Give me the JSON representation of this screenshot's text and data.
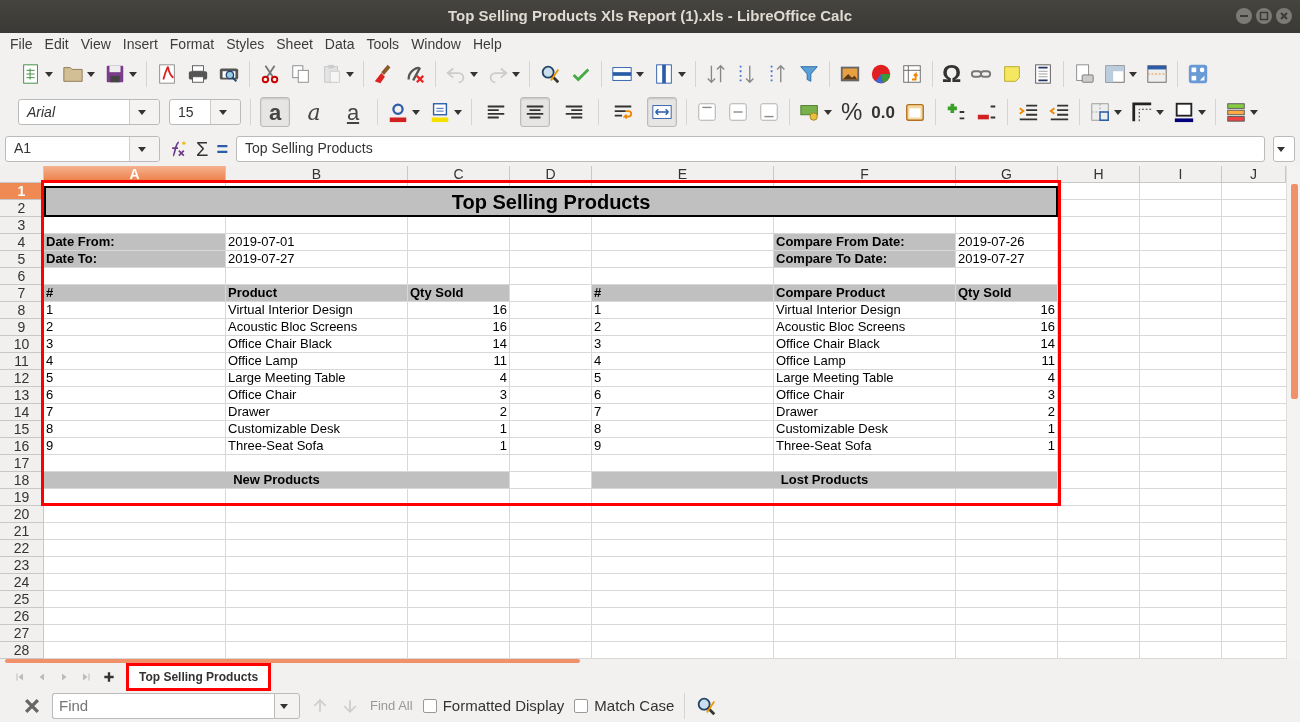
{
  "window": {
    "title": "Top Selling Products Xls Report (1).xls - LibreOffice Calc"
  },
  "menu": [
    "File",
    "Edit",
    "View",
    "Insert",
    "Format",
    "Styles",
    "Sheet",
    "Data",
    "Tools",
    "Window",
    "Help"
  ],
  "toolbar_standard": {
    "special_character_glyph": "Ω"
  },
  "toolbar_format": {
    "font_name": "Arial",
    "font_size": "15",
    "text_style_buttons": [
      {
        "glyph": "a",
        "kind": "bold",
        "selected": true
      },
      {
        "glyph": "a",
        "kind": "italic",
        "selected": false
      },
      {
        "glyph": "a",
        "kind": "underline",
        "selected": false
      }
    ],
    "align_buttons": [
      {
        "kind": "left",
        "selected": false
      },
      {
        "kind": "center",
        "selected": true
      },
      {
        "kind": "right",
        "selected": false
      }
    ],
    "wrap_merge_buttons": [
      {
        "kind": "wrap",
        "selected": false
      },
      {
        "kind": "merge",
        "selected": true
      }
    ],
    "number_glyphs": [
      "%",
      "0.0"
    ]
  },
  "formula_bar": {
    "name_box": "A1",
    "glyphs": [
      "Σ",
      "="
    ],
    "content": "Top Selling Products"
  },
  "sheet": {
    "columns": [
      {
        "label": "A",
        "selected": true
      },
      {
        "label": "B",
        "selected": false
      },
      {
        "label": "C",
        "selected": false
      },
      {
        "label": "D",
        "selected": false
      },
      {
        "label": "E",
        "selected": false
      },
      {
        "label": "F",
        "selected": false
      },
      {
        "label": "G",
        "selected": false
      },
      {
        "label": "H",
        "selected": false
      },
      {
        "label": "I",
        "selected": false
      },
      {
        "label": "J",
        "selected": false
      }
    ],
    "rows": [
      {
        "label": "1",
        "selected": true
      },
      {
        "label": "2",
        "selected": false
      },
      {
        "label": "3",
        "selected": false
      },
      {
        "label": "4",
        "selected": false
      },
      {
        "label": "5",
        "selected": false
      },
      {
        "label": "6",
        "selected": false
      },
      {
        "label": "7",
        "selected": false
      },
      {
        "label": "8",
        "selected": false
      },
      {
        "label": "9",
        "selected": false
      },
      {
        "label": "10",
        "selected": false
      },
      {
        "label": "11",
        "selected": false
      },
      {
        "label": "12",
        "selected": false
      },
      {
        "label": "13",
        "selected": false
      },
      {
        "label": "14",
        "selected": false
      },
      {
        "label": "15",
        "selected": false
      },
      {
        "label": "16",
        "selected": false
      },
      {
        "label": "17",
        "selected": false
      },
      {
        "label": "18",
        "selected": false
      },
      {
        "label": "19",
        "selected": false
      },
      {
        "label": "20",
        "selected": false
      },
      {
        "label": "21",
        "selected": false
      },
      {
        "label": "22",
        "selected": false
      },
      {
        "label": "23",
        "selected": false
      },
      {
        "label": "24",
        "selected": false
      },
      {
        "label": "25",
        "selected": false
      },
      {
        "label": "26",
        "selected": false
      },
      {
        "label": "27",
        "selected": false
      },
      {
        "label": "28",
        "selected": false
      }
    ]
  },
  "report": {
    "title": "Top Selling Products",
    "date_from_label": "Date From:",
    "date_from": "2019-07-01",
    "date_to_label": "Date To:",
    "date_to": "2019-07-27",
    "compare_from_label": "Compare From Date:",
    "compare_from": "2019-07-26",
    "compare_to_label": "Compare To Date:",
    "compare_to": "2019-07-27",
    "headers": [
      "#",
      "Product",
      "Qty Sold",
      "#",
      "Compare Product",
      "Qty Sold"
    ],
    "products": [
      {
        "rank": "1",
        "product": "Virtual Interior Design",
        "qty": "16"
      },
      {
        "rank": "2",
        "product": "Acoustic Bloc Screens",
        "qty": "16"
      },
      {
        "rank": "3",
        "product": "Office Chair Black",
        "qty": "14"
      },
      {
        "rank": "4",
        "product": "Office Lamp",
        "qty": "11"
      },
      {
        "rank": "5",
        "product": "Large Meeting Table",
        "qty": "4"
      },
      {
        "rank": "6",
        "product": "Office Chair",
        "qty": "3"
      },
      {
        "rank": "7",
        "product": "Drawer",
        "qty": "2"
      },
      {
        "rank": "8",
        "product": "Customizable Desk",
        "qty": "1"
      },
      {
        "rank": "9",
        "product": "Three-Seat Sofa",
        "qty": "1"
      }
    ],
    "compare_products": [
      {
        "rank": "1",
        "product": "Virtual Interior Design",
        "qty": "16"
      },
      {
        "rank": "2",
        "product": "Acoustic Bloc Screens",
        "qty": "16"
      },
      {
        "rank": "3",
        "product": "Office Chair Black",
        "qty": "14"
      },
      {
        "rank": "4",
        "product": "Office Lamp",
        "qty": "11"
      },
      {
        "rank": "5",
        "product": "Large Meeting Table",
        "qty": "4"
      },
      {
        "rank": "6",
        "product": "Office Chair",
        "qty": "3"
      },
      {
        "rank": "7",
        "product": "Drawer",
        "qty": "2"
      },
      {
        "rank": "8",
        "product": "Customizable Desk",
        "qty": "1"
      },
      {
        "rank": "9",
        "product": "Three-Seat Sofa",
        "qty": "1"
      }
    ],
    "new_products": "New Products",
    "lost_products": "Lost Products"
  },
  "sheet_tabs": [
    {
      "label": "Top Selling Products",
      "selected": true
    }
  ],
  "find_bar": {
    "placeholder": "Find",
    "find_all": {
      "label": "Find All",
      "disabled": true
    },
    "options": [
      {
        "label": "Formatted Display",
        "checked": false
      },
      {
        "label": "Match Case",
        "checked": false
      }
    ]
  }
}
